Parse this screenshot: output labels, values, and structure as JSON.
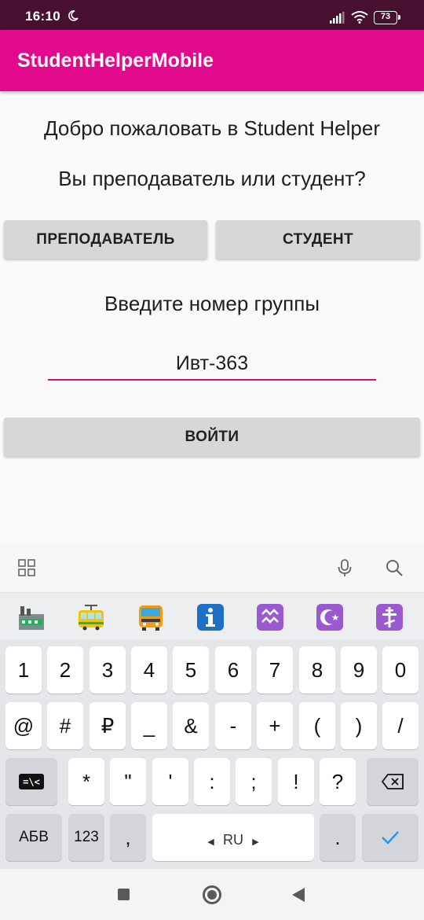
{
  "status_bar": {
    "time": "16:10",
    "battery": "73"
  },
  "app_bar": {
    "title": "StudentHelperMobile"
  },
  "main": {
    "welcome": "Добро пожаловать в Student Helper",
    "question": "Вы преподаватель или студент?",
    "teacher_button": "ПРЕПОДАВАТЕЛЬ",
    "student_button": "СТУДЕНТ",
    "group_label": "Введите номер группы",
    "group_value": "Ивт-363",
    "login_button": "ВОЙТИ"
  },
  "keyboard": {
    "row_numbers": [
      "1",
      "2",
      "3",
      "4",
      "5",
      "6",
      "7",
      "8",
      "9",
      "0"
    ],
    "row_symbols1": [
      "@",
      "#",
      "₽",
      "_",
      "&",
      "-",
      "+",
      "(",
      ")",
      "/"
    ],
    "row_symbols2": [
      "*",
      "\"",
      "'",
      ":",
      ";",
      "!",
      "?"
    ],
    "abc_key": "АБВ",
    "num_key": "123",
    "comma_key": ",",
    "language": "RU",
    "period_key": "."
  },
  "colors": {
    "status_bar": "#47102f",
    "app_bar": "#e20a8c",
    "input_underline": "#d6145f",
    "button_bg": "#d6d7d7",
    "enter_check": "#2196f3"
  }
}
